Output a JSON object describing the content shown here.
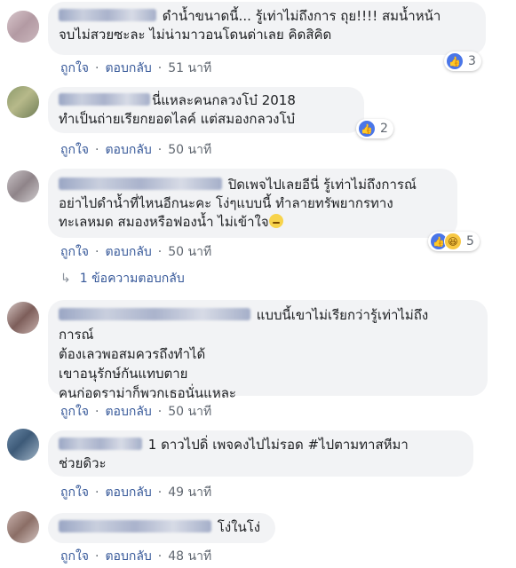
{
  "actions": {
    "like": "ถูกใจ",
    "reply": "ตอบกลับ",
    "dot": "·"
  },
  "comments": [
    {
      "lines": [
        "ดำน้ำขนาดนี้... รู้เท่าไม่ถึงการ ถุย!!!! สมน้ำหน้า",
        "จบไม่สวยซะละ ไม่น่ามาวอนโดนด่าเลย คิดสิคิด"
      ],
      "time": "51 นาที",
      "reactions": {
        "types": [
          "like"
        ],
        "count": "3"
      }
    },
    {
      "lines": [
        "นี่แหละคนกลวงโบ๋ 2018",
        "ทำเป็นถ่ายเรียกยอดไลค์ แต่สมองกลวงโบ๋"
      ],
      "time": "50 นาที",
      "reactions": {
        "types": [
          "like"
        ],
        "count": "2"
      }
    },
    {
      "lines": [
        "ปิดเพจไปเลยอีนี่ รู้เท่าไม่ถึงการณ์",
        "อย่าไปดำน้ำที่ไหนอีกนะคะ โง่ๆแบบนี้ ทำลายทรัพยากรทาง",
        "ทะเลหมด สมองหรือฟองน้ำ ไม่เข้าใจ"
      ],
      "time": "50 นาที",
      "reactions": {
        "types": [
          "like",
          "haha"
        ],
        "count": "5"
      },
      "replies": "1 ข้อความตอบกลับ"
    },
    {
      "lines": [
        "แบบนี้เขาไม่เรียกว่ารู้เท่าไม่ถึง",
        "การณ์",
        "ต้องเลวพอสมควรถึงทำได้",
        "เขาอนุรักษ์กันแทบตาย",
        "คนก่อดราม่าก็พวกเธอนั่นแหละ"
      ],
      "time": "50 นาที"
    },
    {
      "lines": [
        "1 ดาวไปดิ่ เพจคงไปไม่รอด #ไปตามทาสหีมา",
        "ช่วยดิวะ"
      ],
      "time": "49 นาที"
    },
    {
      "lines": [
        "โง่ในโง่"
      ],
      "time": "48 นาที"
    }
  ]
}
